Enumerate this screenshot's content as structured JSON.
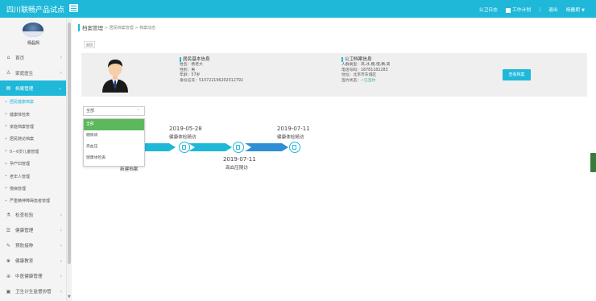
{
  "header": {
    "app_title": "四川联畅产品试点",
    "menu_icon": "hamburger-icon",
    "right_links": {
      "notice": "公卫日志",
      "plan": "工作计划",
      "logout": "退出",
      "user": "杨磊熙"
    }
  },
  "sidebar": {
    "user_name": "杨磊熙",
    "items": [
      {
        "label": "首页",
        "icon": "home-icon"
      },
      {
        "label": "家庭医生",
        "icon": "doctor-icon"
      },
      {
        "label": "档案管理",
        "icon": "archive-icon",
        "active": true,
        "children": [
          "居民健康档案",
          "健康体检表",
          "家庭档案管理",
          "居民随访档案",
          "0－6岁儿童管理",
          "孕产妇管理",
          "老年人管理",
          "慢病管理",
          "严重精神障碍患者管理"
        ],
        "active_child": "居民健康档案"
      },
      {
        "label": "检查检验",
        "icon": "flask-icon"
      },
      {
        "label": "健康管理",
        "icon": "list-icon"
      },
      {
        "label": "预防接种",
        "icon": "syringe-icon"
      },
      {
        "label": "健康教育",
        "icon": "book-icon"
      },
      {
        "label": "中医健康管理",
        "icon": "herb-icon"
      },
      {
        "label": "卫生计生监督协管",
        "icon": "shield-icon"
      }
    ]
  },
  "breadcrumb": {
    "main": "档案管理",
    "path": "> 居民档案管理 > 档案动态"
  },
  "back_label": "返回",
  "info": {
    "basic": {
      "title": "居民基本信息",
      "name": "姓名：杨老大",
      "gender": "性别：男",
      "age": "年龄：57岁",
      "idcard": "身份证号：510722196202012792"
    },
    "gw": {
      "title": "公卫档案信息",
      "type": "人群类型：高,冰,糖,慢,精,高",
      "phone": "电话号码：18781182283",
      "addr": "住址：北京市东城区",
      "sign_label": "签约状态：",
      "sign_value": "✓已签约"
    },
    "view_btn": "查看档案"
  },
  "filter": {
    "selected": "全部",
    "options": [
      "全部",
      "糖尿病",
      "高血压",
      "健康体检表"
    ]
  },
  "timeline": {
    "events": [
      {
        "date": "2019-05-28",
        "label": "健康体检随访"
      },
      {
        "date": "2019-07-11",
        "label": "健康体检随访"
      },
      {
        "date": "2019-07-11",
        "label": "高血压随访"
      },
      {
        "label": "新建档案"
      }
    ]
  },
  "colors": {
    "accent": "#1fb8d9",
    "success": "#5cb85c"
  }
}
